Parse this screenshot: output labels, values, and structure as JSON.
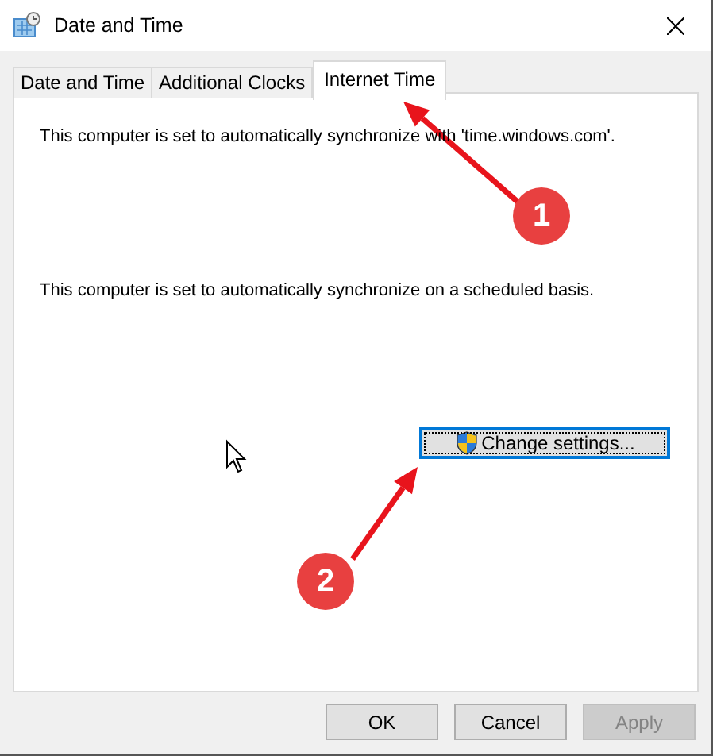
{
  "window": {
    "title": "Date and Time"
  },
  "tabs": [
    {
      "label": "Date and Time",
      "selected": false
    },
    {
      "label": "Additional Clocks",
      "selected": false
    },
    {
      "label": "Internet Time",
      "selected": true
    }
  ],
  "panel": {
    "sync_text": "This computer is set to automatically synchronize with 'time.windows.com'.",
    "schedule_text": "This computer is set to automatically synchronize on a scheduled basis.",
    "change_button": "Change settings..."
  },
  "buttons": [
    {
      "label": "OK",
      "disabled": false
    },
    {
      "label": "Cancel",
      "disabled": false
    },
    {
      "label": "Apply",
      "disabled": true
    }
  ],
  "annotations": [
    {
      "label": "1"
    },
    {
      "label": "2"
    }
  ]
}
